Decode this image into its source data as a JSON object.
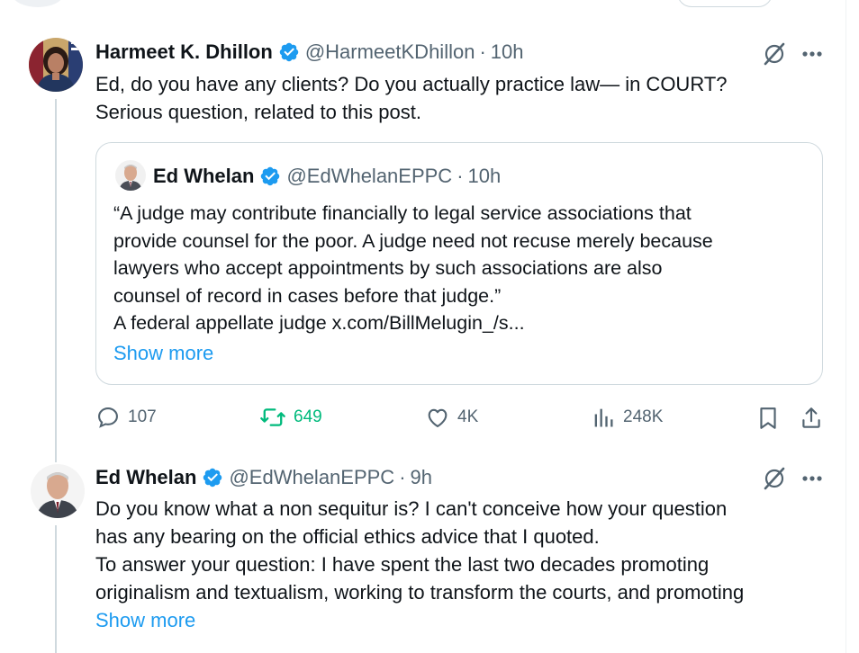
{
  "tweets": [
    {
      "display_name": "Harmeet K. Dhillon",
      "handle": "@HarmeetKDhillon",
      "separator": "·",
      "time": "10h",
      "text_lines": [
        "Ed, do you have any clients? Do you actually practice law— in COURT?",
        "Serious question, related to this post."
      ],
      "quote": {
        "display_name": "Ed Whelan",
        "handle": "@EdWhelanEPPC",
        "separator": "·",
        "time": "10h",
        "text_lines": [
          "“A judge may contribute financially to legal service associations that",
          "provide counsel for the poor. A judge need not recuse merely because",
          "lawyers who accept appointments by such associations are also",
          "counsel of record in cases before that judge.”",
          "A federal appellate judge x.com/BillMelugin_/s..."
        ],
        "show_more": "Show more"
      },
      "actions": {
        "replies": "107",
        "reposts": "649",
        "likes": "4K",
        "views": "248K"
      },
      "reposted_color": "#00ba7c"
    },
    {
      "display_name": "Ed Whelan",
      "handle": "@EdWhelanEPPC",
      "separator": "·",
      "time": "9h",
      "text_lines": [
        "Do you know what a non sequitur is? I can't conceive how your question",
        "has any bearing on the official ethics advice that I quoted.",
        "To answer your question: I have spent the last two decades promoting",
        "originalism and textualism, working to transform the courts, and promoting"
      ],
      "show_more": "Show more"
    }
  ],
  "icons": {
    "verified": "verified-badge-icon",
    "grok": "grok-icon",
    "more": "more-icon",
    "reply": "reply-icon",
    "repost": "repost-icon",
    "like": "like-icon",
    "views": "views-icon",
    "bookmark": "bookmark-icon",
    "share": "share-icon"
  },
  "colors": {
    "link": "#1d9bf0",
    "verified": "#1d9bf0",
    "secondary_text": "#536471",
    "border": "#cfd9de"
  }
}
